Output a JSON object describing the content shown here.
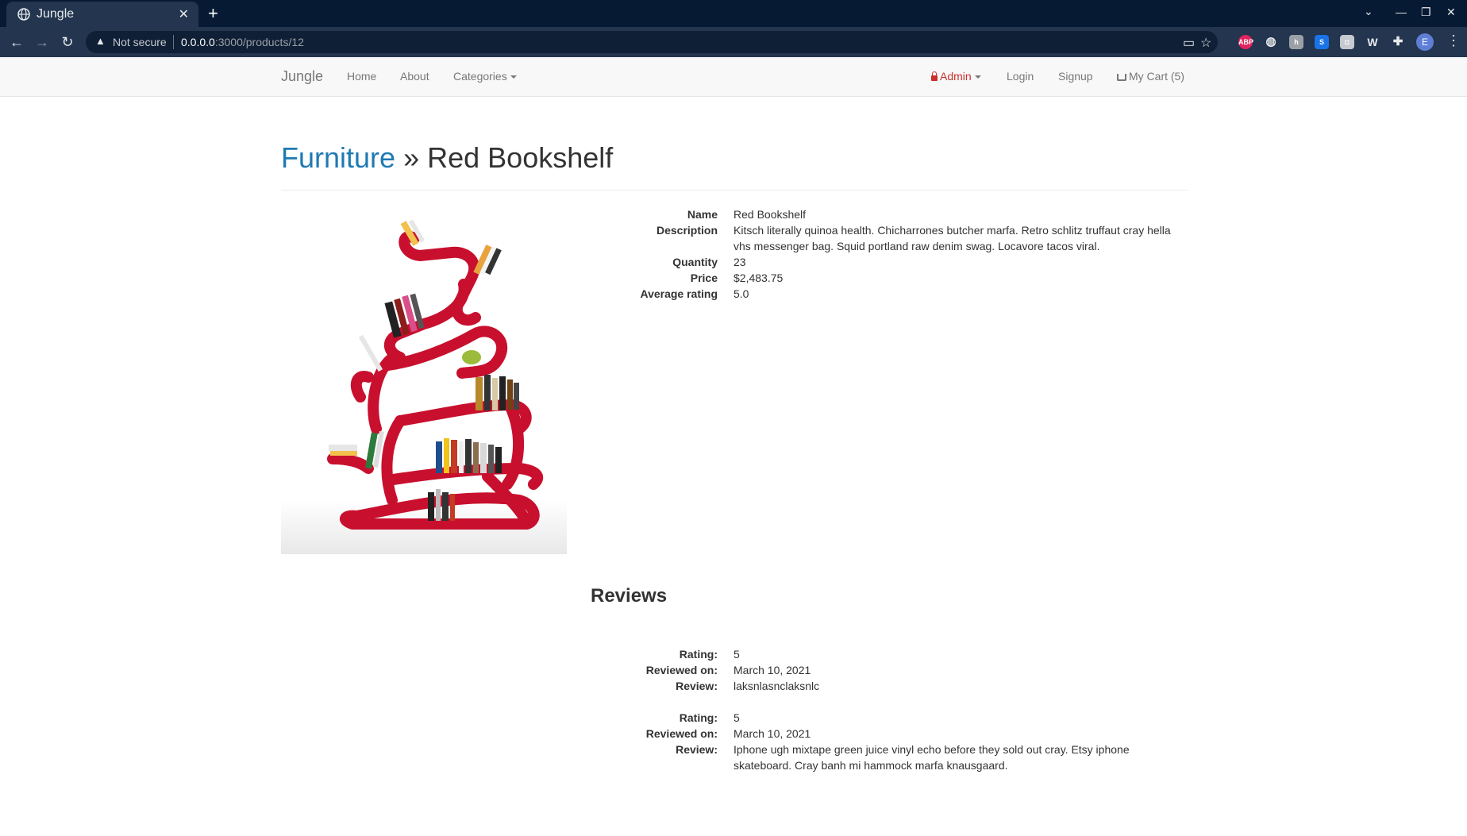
{
  "browser": {
    "tab_title": "Jungle",
    "not_secure": "Not secure",
    "url_host": "0.0.0.0",
    "url_path": ":3000/products/12",
    "profile_initial": "E"
  },
  "navbar": {
    "brand": "Jungle",
    "home": "Home",
    "about": "About",
    "categories": "Categories",
    "admin": "Admin",
    "login": "Login",
    "signup": "Signup",
    "cart": "My Cart (5)"
  },
  "product": {
    "category": "Furniture",
    "separator": "»",
    "title": "Red Bookshelf",
    "details": [
      {
        "label": "Name",
        "value": "Red Bookshelf"
      },
      {
        "label": "Description",
        "value": "Kitsch literally quinoa health. Chicharrones butcher marfa. Retro schlitz truffaut cray hella vhs messenger bag. Squid portland raw denim swag. Locavore tacos viral."
      },
      {
        "label": "Quantity",
        "value": "23"
      },
      {
        "label": "Price",
        "value": "$2,483.75"
      },
      {
        "label": "Average rating",
        "value": "5.0"
      }
    ]
  },
  "reviews": {
    "title": "Reviews",
    "labels": {
      "rating": "Rating:",
      "reviewed_on": "Reviewed on:",
      "review": "Review:"
    },
    "items": [
      {
        "rating": "5",
        "date": "March 10, 2021",
        "text": "laksnlasnclaksnlc"
      },
      {
        "rating": "5",
        "date": "March 10, 2021",
        "text": "Iphone ugh mixtape green juice vinyl echo before they sold out cray. Etsy iphone skateboard. Cray banh mi hammock marfa knausgaard."
      }
    ]
  },
  "colors": {
    "brand_link": "#1f7ab3",
    "admin": "#c9302c",
    "shelf": "#c8102e"
  }
}
